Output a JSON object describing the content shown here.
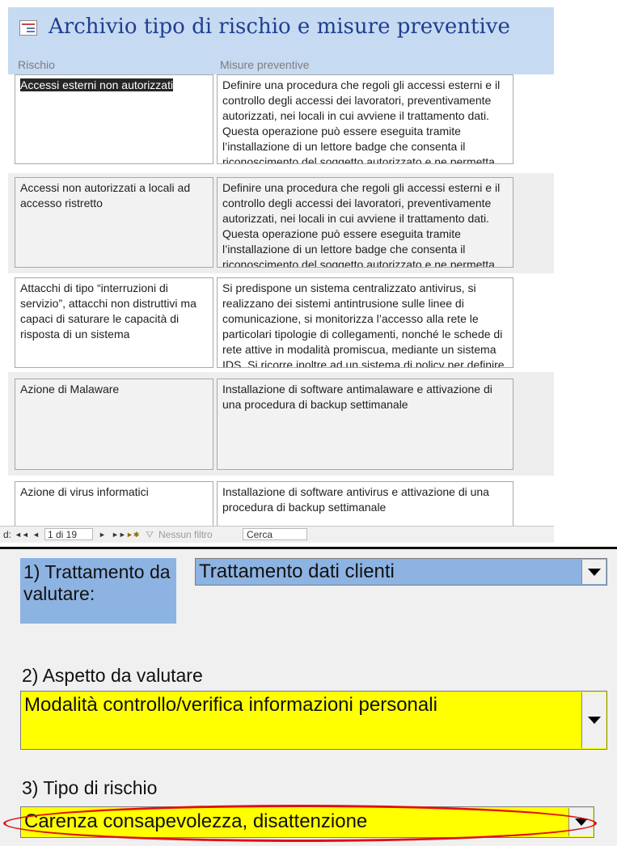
{
  "form": {
    "title": "Archivio tipo di rischio e misure preventive",
    "col_rischio": "Rischio",
    "col_misure": "Misure preventive"
  },
  "records": [
    {
      "rischio": "Accessi esterni non autorizzati",
      "misure": "Definire una procedura che regoli gli accessi esterni e il controllo degli accessi dei lavoratori, preventivamente autorizzati, nei locali in cui avviene il trattamento dati. Questa operazione può essere eseguita tramite l’installazione di un lettore badge che consenta il riconoscimento del soggetto autorizzato e ne permetta"
    },
    {
      "rischio": "Accessi non autorizzati a locali ad accesso ristretto",
      "misure": "Definire una procedura che regoli gli accessi esterni e il controllo degli accessi dei lavoratori, preventivamente autorizzati, nei locali in cui avviene il trattamento dati. Questa operazione può essere eseguita tramite l’installazione di un lettore badge che consenta il riconoscimento del soggetto autorizzato e ne permetta"
    },
    {
      "rischio": "Attacchi di tipo “interruzioni di servizio”, attacchi non distruttivi ma capaci di saturare le capacità di risposta di un sistema",
      "misure": "Si predispone un sistema centralizzato antivirus, si realizzano dei sistemi antintrusione sulle linee di comunicazione, si monitorizza l’accesso alla rete le particolari tipologie di collegamenti, nonché le schede di rete attive in modalità promiscua, mediante un sistema IDS. Si ricorre inoltre ad un sistema di policy per definire"
    },
    {
      "rischio": "Azione di Malaware",
      "misure": "Installazione di software antimalaware e attivazione di una procedura di backup settimanale"
    },
    {
      "rischio": "Azione di virus informatici",
      "misure": "Installazione di software antivirus e attivazione di una procedura di backup settimanale"
    }
  ],
  "nav": {
    "record_prefix": "d:",
    "first": "◄◄",
    "prev": "◄",
    "position": "1 di 19",
    "next": "►",
    "last": "►►",
    "new": "►✱",
    "filter": "Nessun filtro",
    "search_placeholder": "Cerca"
  },
  "panel": {
    "field1_label": "1) Trattamento da valutare:",
    "field1_value": "Trattamento dati clienti",
    "field2_label": "2) Aspetto da valutare",
    "field2_value": "Modalità controllo/verifica informazioni personali",
    "field3_label": "3) Tipo di rischio",
    "field3_value": "Carenza consapevolezza, disattenzione"
  },
  "colors": {
    "header_bg": "#c6daf1",
    "title_color": "#1f3f8f",
    "field1_bg": "#8db3e2",
    "yellow_bg": "#ffff00",
    "highlight_ellipse": "#e01010"
  }
}
